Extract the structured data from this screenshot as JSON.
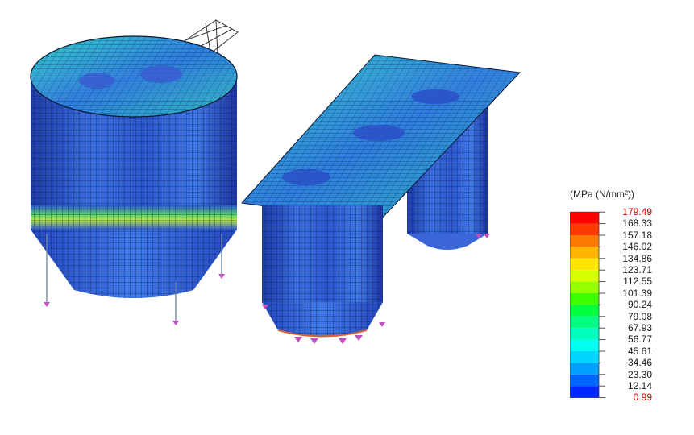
{
  "legend": {
    "unit_label": "(MPa (N/mm²))",
    "levels": [
      {
        "value": "179.49",
        "color": "#ff0000",
        "highlight": true
      },
      {
        "value": "168.33",
        "color": "#ff3a00",
        "highlight": false
      },
      {
        "value": "157.18",
        "color": "#ff7a00",
        "highlight": false
      },
      {
        "value": "146.02",
        "color": "#ffb400",
        "highlight": false
      },
      {
        "value": "134.86",
        "color": "#ffe600",
        "highlight": false
      },
      {
        "value": "123.71",
        "color": "#d8ff00",
        "highlight": false
      },
      {
        "value": "112.55",
        "color": "#96ff00",
        "highlight": false
      },
      {
        "value": "101.39",
        "color": "#3cff00",
        "highlight": false
      },
      {
        "value": "90.24",
        "color": "#00ff3c",
        "highlight": false
      },
      {
        "value": "79.08",
        "color": "#00ff82",
        "highlight": false
      },
      {
        "value": "67.93",
        "color": "#00ffbe",
        "highlight": false
      },
      {
        "value": "56.77",
        "color": "#00fff0",
        "highlight": false
      },
      {
        "value": "45.61",
        "color": "#00d6ff",
        "highlight": false
      },
      {
        "value": "34.46",
        "color": "#00a0ff",
        "highlight": false
      },
      {
        "value": "23.30",
        "color": "#0064ff",
        "highlight": false
      },
      {
        "value": "12.14",
        "color": "#0028ff",
        "highlight": false
      },
      {
        "value": "0.99",
        "color": "#0000ff",
        "highlight": true
      }
    ]
  },
  "model": {
    "mesh_color": "#0a1a33",
    "shell_base_color": "#2a4fd0",
    "hot_color": "#6fd24a",
    "support_color": "#c050c0"
  }
}
